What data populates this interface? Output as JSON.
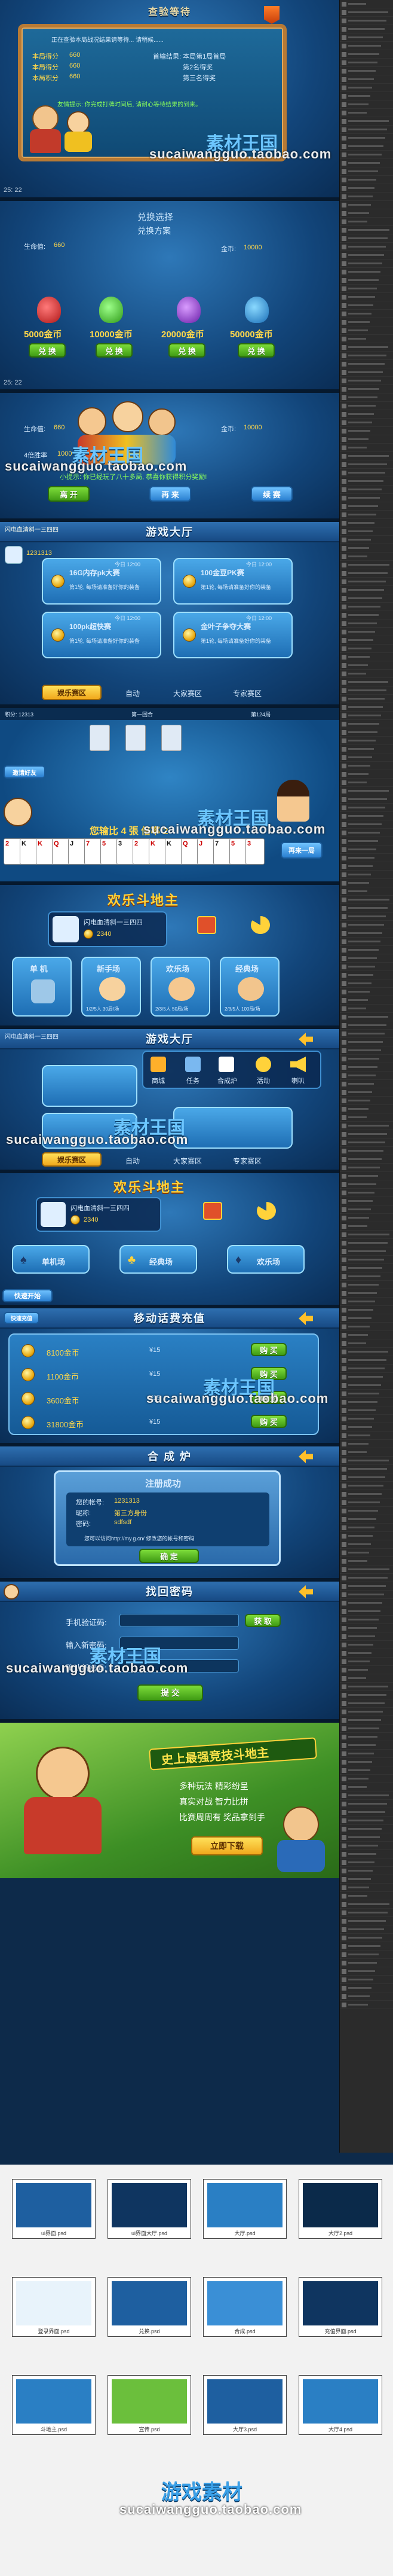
{
  "watermark": {
    "cn": "素材王国",
    "url": "sucaiwangguo.taobao.com"
  },
  "zoom_label": "25: 22",
  "s1": {
    "title": "查验等待",
    "board_line1": "正在查验本局战况结果请等待... 请稍候......",
    "rows": [
      {
        "k": "本局得分",
        "v": "660"
      },
      {
        "k": "本局得分",
        "v": "660"
      },
      {
        "k": "本局积分",
        "v": "660"
      }
    ],
    "right": [
      "首输结果: 本局第1局首局",
      "第2名得奖",
      "第三名得奖"
    ],
    "note": "友情提示: 你完成打牌时间后, 请耐心等待结果的到来。"
  },
  "s2": {
    "title": "兑换选择",
    "subtitle": "兑换方案",
    "life_label": "生命值:",
    "life_val": "660",
    "gold_label": "金币:",
    "gold_val": "10000",
    "options": [
      {
        "amount": "5000金币",
        "btn": "兑 换"
      },
      {
        "amount": "10000金币",
        "btn": "兑 换"
      },
      {
        "amount": "20000金币",
        "btn": "兑 换"
      },
      {
        "amount": "50000金币",
        "btn": "兑 换"
      }
    ]
  },
  "s3": {
    "life_label": "生命值:",
    "life_val": "660",
    "gold_label": "金币:",
    "gold_val": "10000",
    "rate_label": "4倍胜率",
    "rate_val": "1000",
    "hint": "小提示: 你已经玩了八十多局, 恭喜你获得积分奖励!",
    "btn1": "离 开",
    "btn2": "再 来",
    "btn3": "续 赛"
  },
  "s4": {
    "title": "游戏大厅",
    "user": "闪电血清斜一三四四",
    "user_id": "1231313",
    "rooms": [
      {
        "name": "16G内存pk大赛",
        "time": "今日 12:00",
        "desc": "第1轮, 每场请准备好你的装备"
      },
      {
        "name": "100金豆PK赛",
        "time": "今日 12:00",
        "desc": "第1轮, 每场请准备好你的装备"
      },
      {
        "name": "100pk超快赛",
        "time": "今日 12:00",
        "desc": "第1轮, 每场请准备好你的装备"
      },
      {
        "name": "金叶子争夺大赛",
        "time": "今日 12:00",
        "desc": "第1轮, 每场请准备好你的装备"
      }
    ],
    "tabs": [
      "娱乐赛区",
      "自动",
      "大家赛区",
      "专家赛区"
    ]
  },
  "s5": {
    "top_left": "积分: 12313",
    "top_mid": "第一回合",
    "top_right": "第124局",
    "player_btn": "邀请好友",
    "lose_text": "您输比 4 張 倍率 2",
    "cards": [
      "2",
      "K",
      "K",
      "Q",
      "J",
      "7",
      "5",
      "3",
      "2",
      "K",
      "K",
      "Q",
      "J",
      "7",
      "5",
      "3"
    ],
    "replay": "再来一局"
  },
  "s6": {
    "title": "欢乐斗地主",
    "user": "闪电血清斜一三四四",
    "coins": "2340",
    "modes": [
      {
        "label": "单 机",
        "sub": ""
      },
      {
        "label": "新手场",
        "sub": "1/2/5人 30局/场"
      },
      {
        "label": "欢乐场",
        "sub": "2/3/5人 50局/场"
      },
      {
        "label": "经典场",
        "sub": "2/3/5人 100局/场"
      }
    ]
  },
  "s7": {
    "title": "游戏大厅",
    "user": "闪电血清斜一三四四",
    "menu": [
      "商城",
      "任务",
      "合成炉",
      "活动",
      "喇叭"
    ],
    "tabs": [
      "娱乐赛区",
      "自动",
      "大家赛区",
      "专家赛区"
    ]
  },
  "s8": {
    "title": "欢乐斗地主",
    "user": "闪电血清斜一三四四",
    "coins": "2340",
    "modes": [
      "单机场",
      "经典场",
      "欢乐场"
    ],
    "footer": "快速开始"
  },
  "s9": {
    "title": "移动话费充值",
    "tag": "快速充值",
    "items": [
      {
        "amount": "8100金币",
        "price": "¥15",
        "btn": "购 买"
      },
      {
        "amount": "1100金币",
        "price": "¥15",
        "btn": "购 买"
      },
      {
        "amount": "3600金币",
        "price": "¥15",
        "btn": "购 买"
      },
      {
        "amount": "31800金币",
        "price": "¥15",
        "btn": "购 买"
      }
    ]
  },
  "s10": {
    "title": "合 成 炉",
    "dialog_title": "注册成功",
    "lines": [
      {
        "k": "您的帐号:",
        "v": "1231313"
      },
      {
        "k": "昵称:",
        "v": "第三方身份"
      },
      {
        "k": "密码:",
        "v": "sdfsdf"
      }
    ],
    "note": "您可以访问http://my.g.cn/ 修改您的帐号和密码",
    "ok": "确 定"
  },
  "s11": {
    "title": "找回密码",
    "fields": [
      {
        "label": "手机验证码:",
        "btn": "获 取"
      },
      {
        "label": "输入新密码:",
        "btn": ""
      },
      {
        "label": "确认新密码:",
        "btn": ""
      }
    ],
    "submit": "提 交"
  },
  "s12": {
    "headline": "史上最强竞技斗地主",
    "lines": [
      "多种玩法 精彩纷呈",
      "真实对战 智力比拼",
      "比赛周周有 奖品拿到手"
    ],
    "btn": "立即下载"
  },
  "thumbs": [
    {
      "cap": "ui界面.psd"
    },
    {
      "cap": "ui界面大厅.psd"
    },
    {
      "cap": "大厅.psd"
    },
    {
      "cap": "大厅2.psd"
    },
    {
      "cap": "登录界面.psd"
    },
    {
      "cap": "兑换.psd"
    },
    {
      "cap": "合成.psd"
    },
    {
      "cap": "充值界面.psd"
    },
    {
      "cap": "斗地主.psd"
    },
    {
      "cap": "宣传.psd"
    },
    {
      "cap": "大厅3.psd"
    },
    {
      "cap": "大厅4.psd"
    }
  ],
  "promo_banner": "游戏素材",
  "colors": {
    "accent_blue": "#2e78b8",
    "accent_green": "#5fc02a",
    "accent_yellow": "#ffd84a",
    "wood": "#b77a35"
  }
}
